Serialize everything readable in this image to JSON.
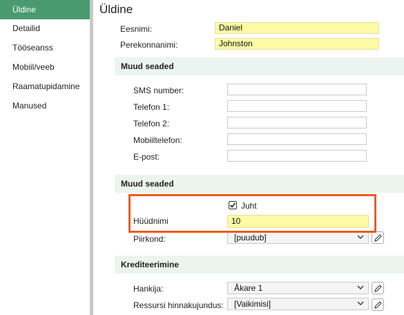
{
  "sidebar": {
    "items": [
      {
        "label": "Üldine",
        "active": true
      },
      {
        "label": "Detailid"
      },
      {
        "label": "Tööseanss"
      },
      {
        "label": "Mobiil/veeb"
      },
      {
        "label": "Raamatupidamine"
      },
      {
        "label": "Manused"
      }
    ]
  },
  "page": {
    "title": "Üldine"
  },
  "basic": {
    "first_name_label": "Eesnimi:",
    "first_name_value": "Daniel",
    "last_name_label": "Perekonnanimi:",
    "last_name_value": "Johnston"
  },
  "section1": {
    "header": "Muud seaded",
    "sms_label": "SMS number:",
    "sms_value": "",
    "phone1_label": "Telefon 1:",
    "phone1_value": "",
    "phone2_label": "Telefon 2:",
    "phone2_value": "",
    "mobile_label": "Mobiiltelefon:",
    "mobile_value": "",
    "email_label": "E-post:",
    "email_value": ""
  },
  "section2": {
    "header": "Muud seaded",
    "checkbox_label": "Juht",
    "checkbox_checked": true,
    "nickname_label": "Hüüdnimi",
    "nickname_value": "10",
    "region_label": "Piirkond:",
    "region_value": "[puudub]"
  },
  "section3": {
    "header": "Krediteerimine",
    "supplier_label": "Hankija:",
    "supplier_value": "Åkare 1",
    "pricing_label": "Ressursi hinnakujundus:",
    "pricing_value": "[Vaikimisi]"
  },
  "colors": {
    "accent": "#4a9a6f",
    "section_bg": "#ebf4ef",
    "highlight": "#ee5a1e",
    "yellow_field": "#fffaa6"
  }
}
